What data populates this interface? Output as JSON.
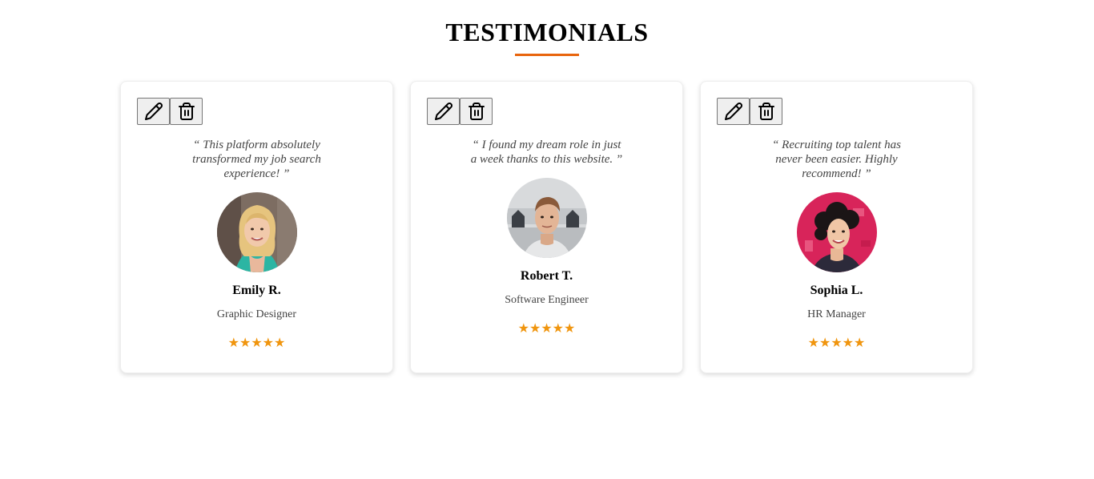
{
  "section": {
    "title": "TESTIMONIALS",
    "accent_color": "#e8650e"
  },
  "actions": {
    "edit_icon": "pencil-icon",
    "delete_icon": "trash-icon"
  },
  "testimonials": [
    {
      "quote": "“ This platform absolutely transformed my job search experience! ”",
      "name": "Emily R.",
      "role": "Graphic Designer",
      "rating": 5,
      "stars": "★★★★★"
    },
    {
      "quote": "“ I found my dream role in just a week thanks to this website. ”",
      "name": "Robert T.",
      "role": "Software Engineer",
      "rating": 5,
      "stars": "★★★★★"
    },
    {
      "quote": "“ Recruiting top talent has never been easier. Highly recommend! ”",
      "name": "Sophia L.",
      "role": "HR Manager",
      "rating": 5,
      "stars": "★★★★★"
    }
  ],
  "colors": {
    "star": "#f0950e",
    "quote_text": "#444444"
  }
}
